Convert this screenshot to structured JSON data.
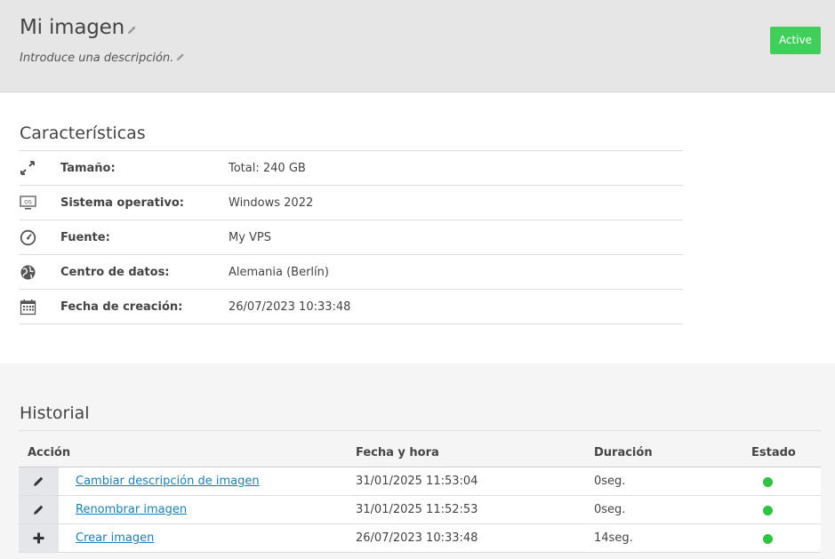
{
  "header": {
    "title": "Mi imagen",
    "description": "Introduce una descripción.",
    "status_button": "Active",
    "status_color": "#3fcf5a"
  },
  "characteristics": {
    "title": "Características",
    "rows": [
      {
        "icon": "resize-icon",
        "label": "Tamaño:",
        "value": "Total: 240 GB"
      },
      {
        "icon": "os-monitor-icon",
        "label": "Sistema operativo:",
        "value": "Windows 2022"
      },
      {
        "icon": "gauge-icon",
        "label": "Fuente:",
        "value": "My VPS"
      },
      {
        "icon": "globe-icon",
        "label": "Centro de datos:",
        "value": "Alemania (Berlín)"
      },
      {
        "icon": "calendar-icon",
        "label": "Fecha de creación:",
        "value": "26/07/2023 10:33:48"
      }
    ]
  },
  "history": {
    "title": "Historial",
    "columns": [
      "Acción",
      "Fecha y hora",
      "Duración",
      "Estado"
    ],
    "rows": [
      {
        "icon": "pencil-icon",
        "action": "Cambiar descripción de imagen",
        "datetime": "31/01/2025 11:53:04",
        "duration": "0seg.",
        "status": "ok"
      },
      {
        "icon": "pencil-icon",
        "action": "Renombrar imagen",
        "datetime": "31/01/2025 11:52:53",
        "duration": "0seg.",
        "status": "ok"
      },
      {
        "icon": "plus-icon",
        "action": "Crear imagen",
        "datetime": "26/07/2023 10:33:48",
        "duration": "14seg.",
        "status": "ok"
      }
    ],
    "status_color": "#2fc243"
  }
}
